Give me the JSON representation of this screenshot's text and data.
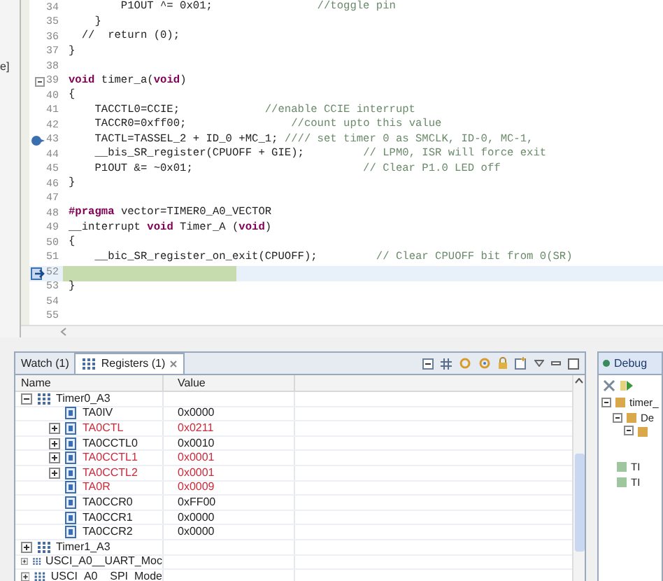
{
  "left_edge": {
    "text": "e]"
  },
  "editor": {
    "lines": [
      {
        "number": "34",
        "code": "        P1OUT ^= 0x01;",
        "comment": "                //toggle pin",
        "kind": "plain"
      },
      {
        "number": "35",
        "code": "    }",
        "kind": "plain"
      },
      {
        "number": "36",
        "code": "  //  return (0);",
        "kind": "plain"
      },
      {
        "number": "37",
        "code": "}",
        "kind": "plain"
      },
      {
        "number": "38",
        "kind": "plain"
      },
      {
        "number": "39",
        "code": "**void** timer_a(**void**)",
        "kind": "fold"
      },
      {
        "number": "40",
        "code": "{",
        "kind": "plain"
      },
      {
        "number": "41",
        "code": "    TACCTL0=CCIE;",
        "comment": "             //enable CCIE interrupt",
        "kind": "plain"
      },
      {
        "number": "42",
        "code": "    TACCR0=0xff00;",
        "comment": "                //count upto this value",
        "kind": "plain"
      },
      {
        "number": "43",
        "code": "    TACTL=TASSEL_2 + ID_0 +MC_1;",
        "comment": " //// set timer 0 as SMCLK, ID-0, MC-1,",
        "kind": "breakpoint"
      },
      {
        "number": "44",
        "code": "    __bis_SR_register(CPUOFF + GIE);",
        "comment": "         // LPM0, ISR will force exit",
        "kind": "plain"
      },
      {
        "number": "45",
        "code": "    P1OUT &= ~0x01;",
        "comment": "                          // Clear P1.0 LED off",
        "kind": "plain"
      },
      {
        "number": "46",
        "code": "}",
        "kind": "plain"
      },
      {
        "number": "47",
        "kind": "plain"
      },
      {
        "number": "48",
        "code": "**#pragma** vector=TIMER0_A0_VECTOR",
        "kind": "plain"
      },
      {
        "number": "49",
        "code": "__interrupt **void** Timer_A (**void**)",
        "kind": "plain"
      },
      {
        "number": "50",
        "code": "{",
        "kind": "plain"
      },
      {
        "number": "51",
        "code": "    __bic_SR_register_on_exit(CPUOFF);",
        "comment": "         // Clear CPUOFF bit from 0(SR)",
        "kind": "plain"
      },
      {
        "number": "52",
        "kind": "current"
      },
      {
        "number": "53",
        "code": "}",
        "kind": "plain"
      },
      {
        "number": "54",
        "kind": "plain"
      },
      {
        "number": "55",
        "kind": "plain"
      }
    ]
  },
  "registers_panel": {
    "tabs": [
      {
        "label": "Watch (1)",
        "selected": false,
        "kind": "watch"
      },
      {
        "label": "Registers (1)",
        "selected": true,
        "kind": "registers"
      }
    ],
    "columns": [
      "Name",
      "Value"
    ],
    "rows": [
      {
        "name": "Timer0_A3",
        "expanded": true,
        "changed": false,
        "children": [
          {
            "name": "TA0IV",
            "value": "0x0000",
            "expandable": false,
            "changed": false
          },
          {
            "name": "TA0CTL",
            "value": "0x0211",
            "expandable": true,
            "changed": true
          },
          {
            "name": "TA0CCTL0",
            "value": "0x0010",
            "expandable": true,
            "changed": false
          },
          {
            "name": "TA0CCTL1",
            "value": "0x0001",
            "expandable": true,
            "changed": true
          },
          {
            "name": "TA0CCTL2",
            "value": "0x0001",
            "expandable": true,
            "changed": true
          },
          {
            "name": "TA0R",
            "value": "0x0009",
            "expandable": false,
            "changed": true
          },
          {
            "name": "TA0CCR0",
            "value": "0xFF00",
            "expandable": false,
            "changed": false
          },
          {
            "name": "TA0CCR1",
            "value": "0x0000",
            "expandable": false,
            "changed": false
          },
          {
            "name": "TA0CCR2",
            "value": "0x0000",
            "expandable": false,
            "changed": false
          }
        ]
      },
      {
        "name": "Timer1_A3",
        "expanded": false,
        "changed": false
      },
      {
        "name": "USCI_A0__UART_Moc",
        "expanded": false,
        "changed": false
      },
      {
        "name": "USCI_A0__SPI_Mode",
        "expanded": false,
        "changed": false
      }
    ]
  },
  "debug_panel": {
    "title": "Debug",
    "items": [
      {
        "label": "timer_",
        "kind": "top"
      },
      {
        "label": "De",
        "kind": "device"
      },
      {
        "kind": "thread"
      },
      {
        "label": "TI",
        "kind": "process"
      },
      {
        "label": "TI",
        "kind": "process"
      }
    ]
  }
}
